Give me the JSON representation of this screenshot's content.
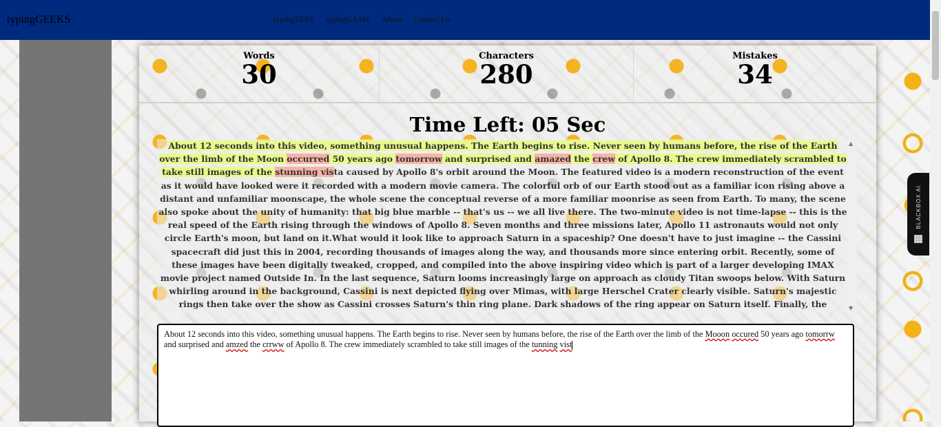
{
  "nav": {
    "brand": "typingGEEKS",
    "links": [
      "typingTEST",
      "typingGAME",
      "About",
      "Contact Us"
    ]
  },
  "stats": {
    "words": {
      "label": "Words",
      "value": "30"
    },
    "characters": {
      "label": "Characters",
      "value": "280"
    },
    "mistakes": {
      "label": "Mistakes",
      "value": "34"
    }
  },
  "timer": "Time Left: 05 Sec",
  "passage": {
    "seg1": "About 12 seconds into this video, something unusual happens. The Earth begins to rise. Never seen by humans before, the rise of the Earth over the limb of the Moon ",
    "seg2": "occurred",
    "seg3": " 50 years ago ",
    "seg4": "tomorrow",
    "seg5": " and surprised and ",
    "seg6": "amazed",
    "seg7": " the ",
    "seg8": "crew",
    "seg9": " of Apollo 8. The crew immediately scrambled to take still images of the ",
    "seg10": "stunning",
    "seg11": " vis",
    "seg12": "ta caused by Apollo 8's orbit around the Moon. The featured video is a modern reconstruction of the event as it would have looked were it recorded with a modern movie camera. The colorful orb of our Earth stood out as a familiar icon rising above a distant and unfamiliar moonscape, the whole scene the conceptual reverse of a more familiar moonrise as seen from Earth. To many, the scene also spoke about the unity of humanity: that big blue marble -- that's us -- we all live there. The two-minute video is not time-lapse -- this is the real speed of the Earth rising through the windows of Apollo 8. Seven months and three missions later, Apollo 11 astronauts would not only circle Earth's moon, but land on it.What would it look like to approach Saturn in a spaceship? One doesn't have to just imagine -- the Cassini spacecraft did just this in 2004, recording thousands of images along the way, and thousands more since entering orbit. Recently, some of these images have been digitally tweaked, cropped, and compiled into the above inspiring video which is part of a larger developing IMAX movie project named Outside In. In the last sequence, Saturn looms increasingly large on approach as cloudy Titan swoops below. With Saturn whirling around in the background, Cassini is next depicted flying over Mimas, with large Herschel Crater clearly visible. Saturn's majestic rings then take over the show as Cassini crosses Saturn's thin ring plane. Dark shadows of the ring appear on Saturn itself. Finally, the enigmatic ice-geyser moon Enceladus appears in the distance and then is approached just as the video clip ends."
  },
  "typed": {
    "t1": "About 12 seconds into this video, something unusual happens. The Earth begins to rise.  Never seen by humans before, the rise of the Earth over the limb of the ",
    "t2": "Mooon",
    "t3": " ",
    "t4": "occured",
    "t5": " 50 years ago ",
    "t6": "tomorrw",
    "t7": " and  surprised and ",
    "t8": "amzed",
    "t9": " the ",
    "t10": "crrww",
    "t11": " of Apollo 8. The crew immediately scrambled to take still images of the ",
    "t12": "tunning",
    "t13": " ",
    "t14": "vist"
  },
  "widget": {
    "label": "BLACKBOX AI"
  }
}
